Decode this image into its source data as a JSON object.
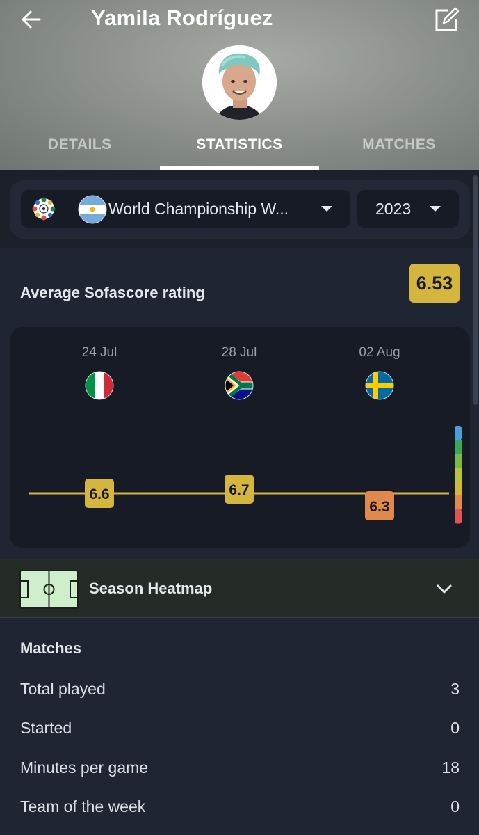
{
  "header": {
    "title": "Yamila Rodríguez",
    "tabs": [
      {
        "label": "DETAILS",
        "active": false
      },
      {
        "label": "STATISTICS",
        "active": true
      },
      {
        "label": "MATCHES",
        "active": false
      }
    ]
  },
  "filters": {
    "league": "World Championship W...",
    "year": "2023"
  },
  "rating": {
    "label": "Average Sofascore rating",
    "value": "6.53",
    "badge_color": "#d4b53d"
  },
  "chart_data": {
    "type": "line",
    "x": [
      "24 Jul",
      "28 Jul",
      "02 Aug"
    ],
    "opponents": [
      "italy-flag-icon",
      "south-africa-flag-icon",
      "sweden-flag-icon"
    ],
    "series": [
      {
        "values": [
          6.6,
          6.7,
          6.3
        ]
      }
    ],
    "point_colors": [
      "#d4b53d",
      "#d4b53d",
      "#e0894d"
    ],
    "scale_colors": [
      "#4a9fd8",
      "#3aa65a",
      "#7ab84a",
      "#b9c23c",
      "#d4b53d",
      "#e0894d",
      "#e2525a"
    ]
  },
  "heatmap": {
    "label": "Season Heatmap"
  },
  "matches": {
    "title": "Matches",
    "rows": [
      {
        "label": "Total played",
        "value": "3"
      },
      {
        "label": "Started",
        "value": "0"
      },
      {
        "label": "Minutes per game",
        "value": "18"
      },
      {
        "label": "Team of the week",
        "value": "0"
      }
    ]
  }
}
